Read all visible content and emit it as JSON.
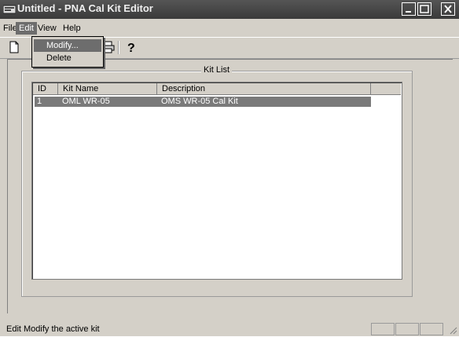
{
  "window": {
    "title": "Untitled - PNA Cal Kit Editor"
  },
  "menubar": {
    "items": [
      "File",
      "Edit",
      "View",
      "Help"
    ]
  },
  "edit_menu": {
    "items": [
      "Modify...",
      "Delete"
    ]
  },
  "toolbar": {
    "icons": [
      "new-document-icon",
      "print-icon",
      "help-icon"
    ]
  },
  "kit_list": {
    "label": "Kit List",
    "columns": [
      "ID",
      "Kit Name",
      "Description"
    ],
    "rows": [
      {
        "id": "1",
        "name": "OML WR-05",
        "description": "OMS WR-05 Cal Kit"
      }
    ]
  },
  "statusbar": {
    "text": "Edit Modify the active kit"
  },
  "colors": {
    "titlebar": "#3a3a3a",
    "selection": "#6d6d6d",
    "face": "#d4d0c8"
  }
}
